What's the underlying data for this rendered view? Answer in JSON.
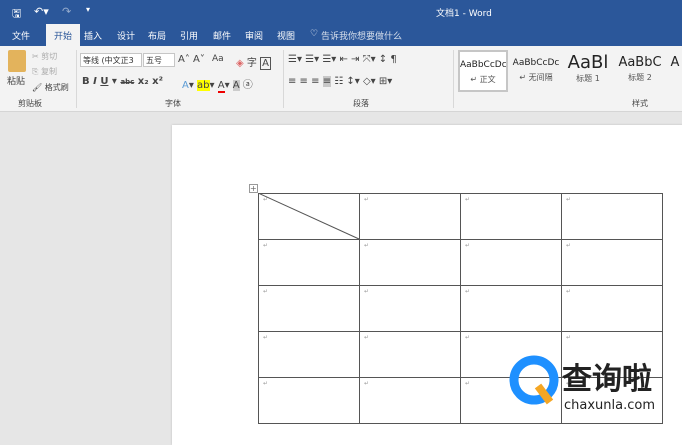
{
  "title_bar": {
    "title": "文档1 - Word",
    "quick_access": [
      "save-icon",
      "undo-icon",
      "redo-icon",
      "customize-icon"
    ]
  },
  "tabs": [
    "文件",
    "开始",
    "插入",
    "设计",
    "布局",
    "引用",
    "邮件",
    "审阅",
    "视图"
  ],
  "tell_me": "告诉我你想要做什么",
  "clipboard": {
    "paste": "粘贴",
    "cut": "剪切",
    "copy": "复制",
    "format_painter": "格式刷",
    "label": "剪贴板"
  },
  "font": {
    "name": "等线 (中文正3",
    "size": "五号",
    "label": "字体",
    "change_case": "Aa"
  },
  "paragraph": {
    "label": "段落"
  },
  "styles": {
    "label": "样式",
    "items": [
      {
        "preview": "AaBbCcDc",
        "name": "正文"
      },
      {
        "preview": "AaBbCcDc",
        "name": "无间隔"
      },
      {
        "preview": "AaBl",
        "name": "标题 1"
      },
      {
        "preview": "AaBbC",
        "name": "标题 2"
      },
      {
        "preview": "A",
        "name": ""
      }
    ]
  },
  "table": {
    "rows": 5,
    "cols": 4,
    "cell_mark": "↵"
  },
  "watermark": {
    "brand": "查询啦",
    "url": "chaxunla.com"
  }
}
